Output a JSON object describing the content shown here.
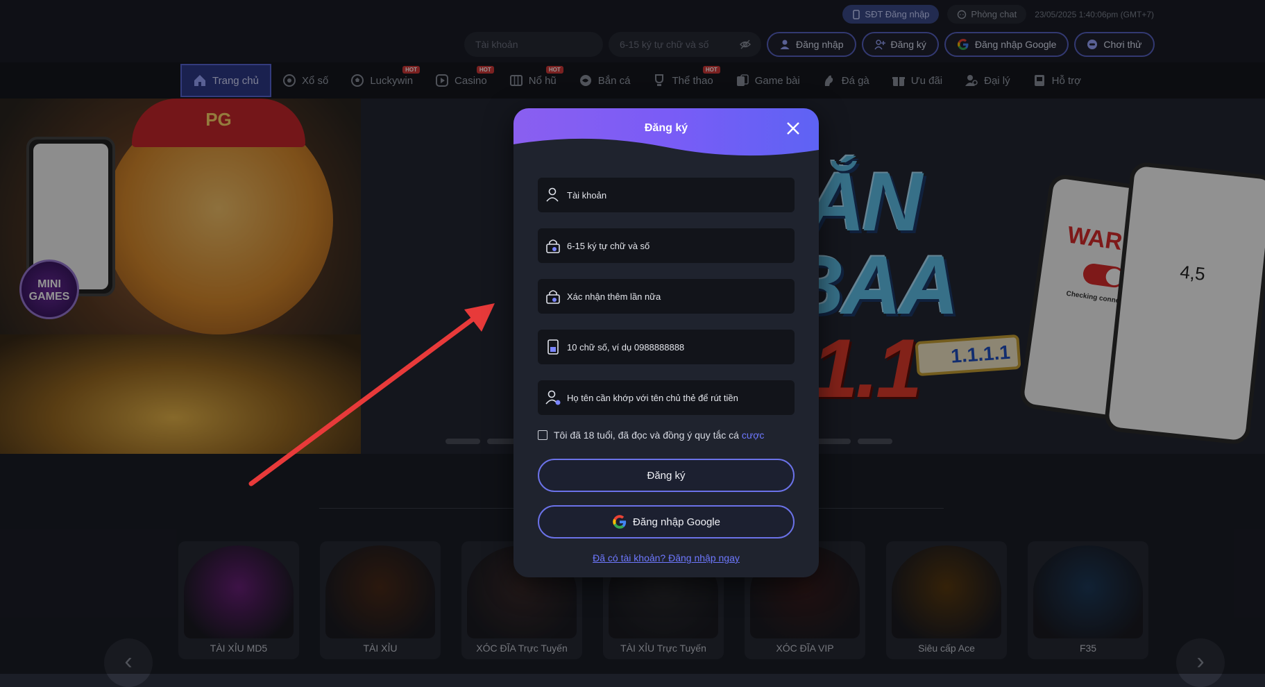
{
  "topbar": {
    "phone_login": "SĐT Đăng nhập",
    "chat": "Phòng chat",
    "timestamp": "23/05/2025 1:40:06pm",
    "timezone": "(GMT+7)",
    "account_placeholder": "Tài khoản",
    "password_placeholder": "6-15 ký tự chữ và số",
    "login": "Đăng nhập",
    "register": "Đăng ký",
    "google_login": "Đăng nhập Google",
    "trial": "Chơi thử"
  },
  "nav": {
    "items": [
      {
        "label": "Trang chủ",
        "hot": ""
      },
      {
        "label": "Xổ số",
        "hot": ""
      },
      {
        "label": "Luckywin",
        "hot": "HOT"
      },
      {
        "label": "Casino",
        "hot": "HOT"
      },
      {
        "label": "Nổ hũ",
        "hot": "HOT"
      },
      {
        "label": "Bắn cá",
        "hot": ""
      },
      {
        "label": "Thể thao",
        "hot": "HOT"
      },
      {
        "label": "Game bài",
        "hot": ""
      },
      {
        "label": "Đá gà",
        "hot": ""
      },
      {
        "label": "Ưu đãi",
        "hot": ""
      },
      {
        "label": "Đại lý",
        "hot": ""
      },
      {
        "label": "Hỗ trợ",
        "hot": ""
      }
    ]
  },
  "banner": {
    "cap_text": "PG",
    "minigames": "MINI GAMES",
    "big_letters_1": "ẮN",
    "big_letters_2": "BAA",
    "big_letters_3": "1.1",
    "warp": "WARP",
    "checking": "Checking connection",
    "rating": "4,5",
    "badge": "1.1.1.1"
  },
  "games": [
    {
      "name": "TÀI XỈU MD5",
      "color": "#6a1f7a"
    },
    {
      "name": "TÀI XỈU",
      "color": "#4a2a18"
    },
    {
      "name": "XÓC ĐĨA Trực Tuyến",
      "color": "#3a2a2a"
    },
    {
      "name": "TÀI XỈU Trực Tuyến",
      "color": "#2a2a2e"
    },
    {
      "name": "XÓC ĐĨA VIP",
      "color": "#3a1e1e"
    },
    {
      "name": "Siêu cấp Ace",
      "color": "#5a3a10"
    },
    {
      "name": "F35",
      "color": "#1e3a5a"
    }
  ],
  "modal": {
    "title": "Đăng ký",
    "fields": {
      "account": "Tài khoản",
      "password": "6-15 ký tự chữ và số",
      "confirm": "Xác nhận thêm lần nữa",
      "phone": "10 chữ số, ví dụ 0988888888",
      "fullname": "Họ tên cần khớp với tên chủ thẻ để rút tiền"
    },
    "agree_text": "Tôi đã 18 tuổi, đã đọc và đồng ý quy tắc cá",
    "agree_link": "cược",
    "register_button": "Đăng ký",
    "google_button": "Đăng nhập Google",
    "login_link": "Đã có tài khoản? Đăng nhập ngay"
  },
  "colors": {
    "accent": "#5863c4",
    "modal_header": "#7a5cf6",
    "link": "#6e78ff",
    "hot": "#d23a3a",
    "arrow": "#e83a3a"
  }
}
